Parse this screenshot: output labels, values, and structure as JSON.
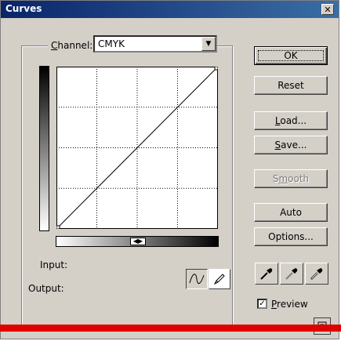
{
  "window": {
    "title": "Curves",
    "close_glyph": "✕"
  },
  "channel": {
    "label_pre": "",
    "label_mnemonic": "C",
    "label_post": "hannel:",
    "value": "CMYK"
  },
  "labels": {
    "input": "Input:",
    "output": "Output:"
  },
  "buttons": {
    "ok": "OK",
    "reset": "Reset",
    "load_mn": "L",
    "load_rest": "oad...",
    "save_mn": "S",
    "save_rest": "ave...",
    "smooth_pre": "S",
    "smooth_mn": "m",
    "smooth_rest": "ooth",
    "auto": "Auto",
    "options": "Options..."
  },
  "preview": {
    "mnemonic": "P",
    "rest": "review",
    "checked": "✓"
  },
  "curve": {
    "type": "line",
    "points": [
      [
        0,
        0
      ],
      [
        255,
        255
      ]
    ]
  },
  "colors": {
    "accent_red": "#e00000",
    "dialog": "#d4d0c8"
  }
}
